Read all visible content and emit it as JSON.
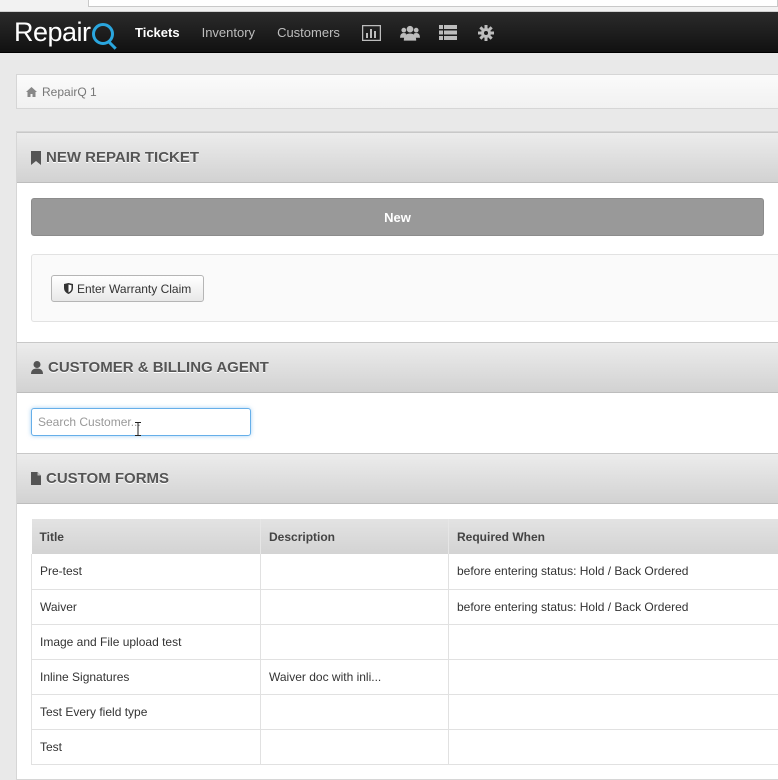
{
  "nav": {
    "brand": "Repair",
    "links": [
      {
        "label": "Tickets",
        "active": true
      },
      {
        "label": "Inventory",
        "active": false
      },
      {
        "label": "Customers",
        "active": false
      }
    ],
    "icons": [
      "bar-chart-icon",
      "users-icon",
      "list-icon",
      "gear-icon"
    ]
  },
  "breadcrumb": {
    "label": "RepairQ 1"
  },
  "sections": {
    "new_ticket": {
      "title": "NEW REPAIR TICKET",
      "new_label": "New",
      "warranty_label": "Enter Warranty Claim"
    },
    "customer": {
      "title": "CUSTOMER & BILLING AGENT",
      "search_placeholder": "Search Customer..."
    },
    "custom_forms": {
      "title": "CUSTOM FORMS",
      "columns": [
        "Title",
        "Description",
        "Required When"
      ],
      "rows": [
        [
          "Pre-test",
          "",
          "before entering status: Hold / Back Ordered"
        ],
        [
          "Waiver",
          "",
          "before entering status: Hold / Back Ordered"
        ],
        [
          "Image and File upload test",
          "",
          ""
        ],
        [
          "Inline Signatures",
          "Waiver doc with inli...",
          ""
        ],
        [
          "Test Every field type",
          "",
          ""
        ],
        [
          "Test",
          "",
          ""
        ]
      ]
    }
  },
  "colors": {
    "accent": "#2aa6de",
    "new_button": "#999999",
    "focus": "#66afe9"
  }
}
